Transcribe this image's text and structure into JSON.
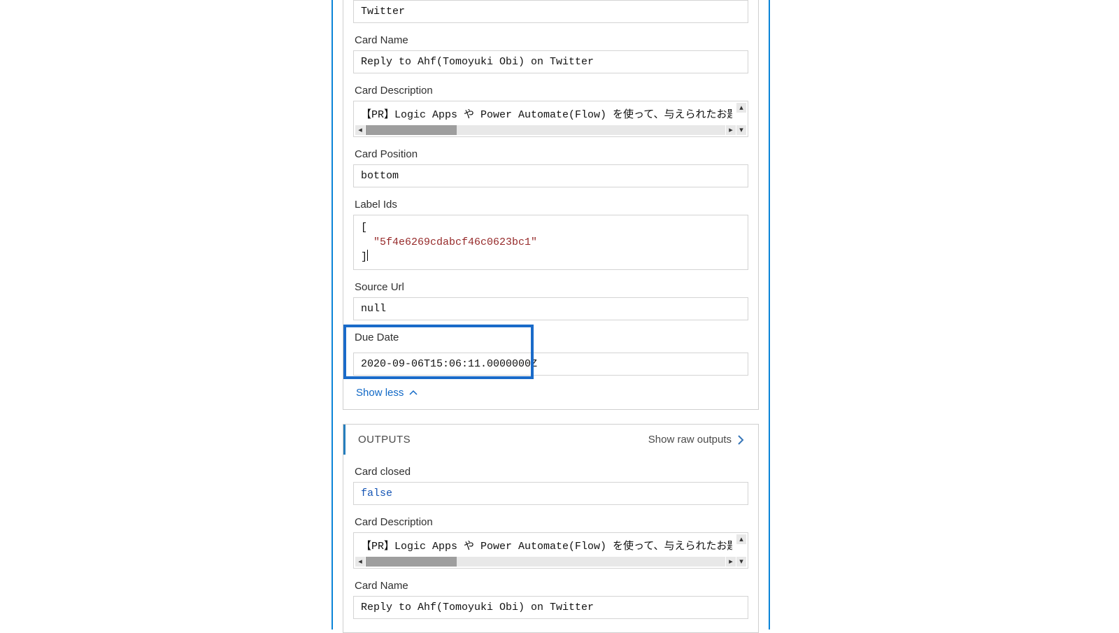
{
  "inputs": {
    "first_box": "Twitter",
    "card_name_label": "Card Name",
    "card_name": "Reply to Ahf(Tomoyuki Obi) on Twitter",
    "card_desc_label": "Card Description",
    "card_desc": "【PR】Logic Apps や Power Automate(Flow) を使って、与えられたお題を",
    "card_pos_label": "Card Position",
    "card_pos": "bottom",
    "label_ids_label": "Label Ids",
    "label_ids_open": "[",
    "label_ids_value": "  \"5f4e6269cdabcf46c0623bc1\"",
    "label_ids_close": "]",
    "source_url_label": "Source Url",
    "source_url": "null",
    "due_date_label": "Due Date",
    "due_date": "2020-09-06T15:06:11.0000000Z",
    "show_less": "Show less"
  },
  "outputs": {
    "bar_title": "OUTPUTS",
    "bar_link": "Show raw outputs",
    "card_closed_label": "Card closed",
    "card_closed": "false",
    "card_desc_label": "Card Description",
    "card_desc": "【PR】Logic Apps や Power Automate(Flow) を使って、与えられたお題を",
    "card_name_label": "Card Name",
    "card_name": "Reply to Ahf(Tomoyuki Obi) on Twitter"
  }
}
